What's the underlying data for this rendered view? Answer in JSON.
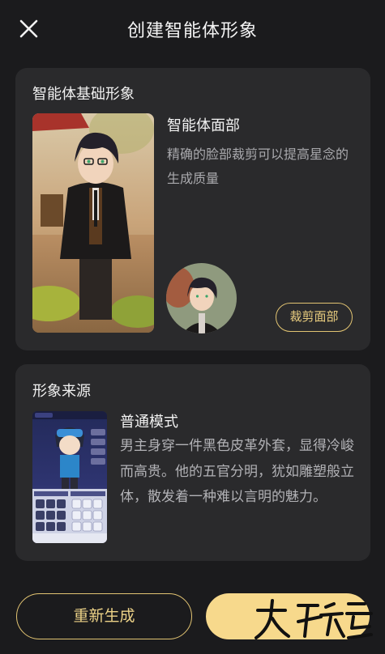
{
  "header": {
    "title": "创建智能体形象"
  },
  "base_card": {
    "title": "智能体基础形象",
    "face_heading": "智能体面部",
    "face_description": "精确的脸部裁剪可以提高星念的生成质量",
    "crop_button": "裁剪面部"
  },
  "source_card": {
    "title": "形象来源",
    "mode_heading": "普通模式",
    "mode_description": "男主身穿一件黑色皮革外套，显得冷峻而高贵。他的五官分明，犹如雕塑般立体，散发着一种难以言明的魅力。"
  },
  "footer": {
    "regenerate_button": "重新生成"
  },
  "colors": {
    "background": "#1b1b1d",
    "card": "#2a2a2c",
    "accent_gold": "#e2c472",
    "primary_button": "#f7d98c"
  },
  "icons": [
    "close-icon",
    "watermark-logo"
  ]
}
